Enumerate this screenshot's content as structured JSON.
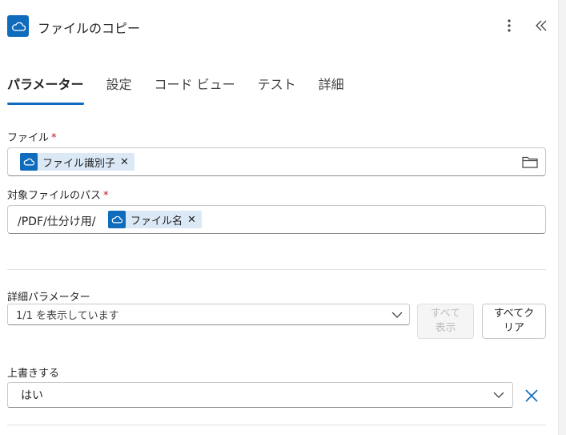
{
  "header": {
    "title": "ファイルのコピー",
    "icon": "onedrive-cloud-icon",
    "accent": "#0f6cbd"
  },
  "tabs": [
    {
      "label": "パラメーター",
      "active": true
    },
    {
      "label": "設定",
      "active": false
    },
    {
      "label": "コード ビュー",
      "active": false
    },
    {
      "label": "テスト",
      "active": false
    },
    {
      "label": "詳細",
      "active": false
    }
  ],
  "file_field": {
    "label": "ファイル",
    "required_mark": "*",
    "token": "ファイル識別子"
  },
  "dest_field": {
    "label": "対象ファイルのパス",
    "required_mark": "*",
    "prefix": "/PDF/仕分け用/",
    "token": "ファイル名"
  },
  "advanced": {
    "label": "詳細パラメーター",
    "select_value": "1/1 を表示しています",
    "show_all_label": "すべて表示",
    "show_all_line1": "すべて",
    "show_all_line2": "表示",
    "clear_all_line1": "すべてク",
    "clear_all_line2": "リア"
  },
  "overwrite": {
    "label": "上書きする",
    "value": "はい"
  },
  "icons": {
    "token_x": "✕"
  }
}
